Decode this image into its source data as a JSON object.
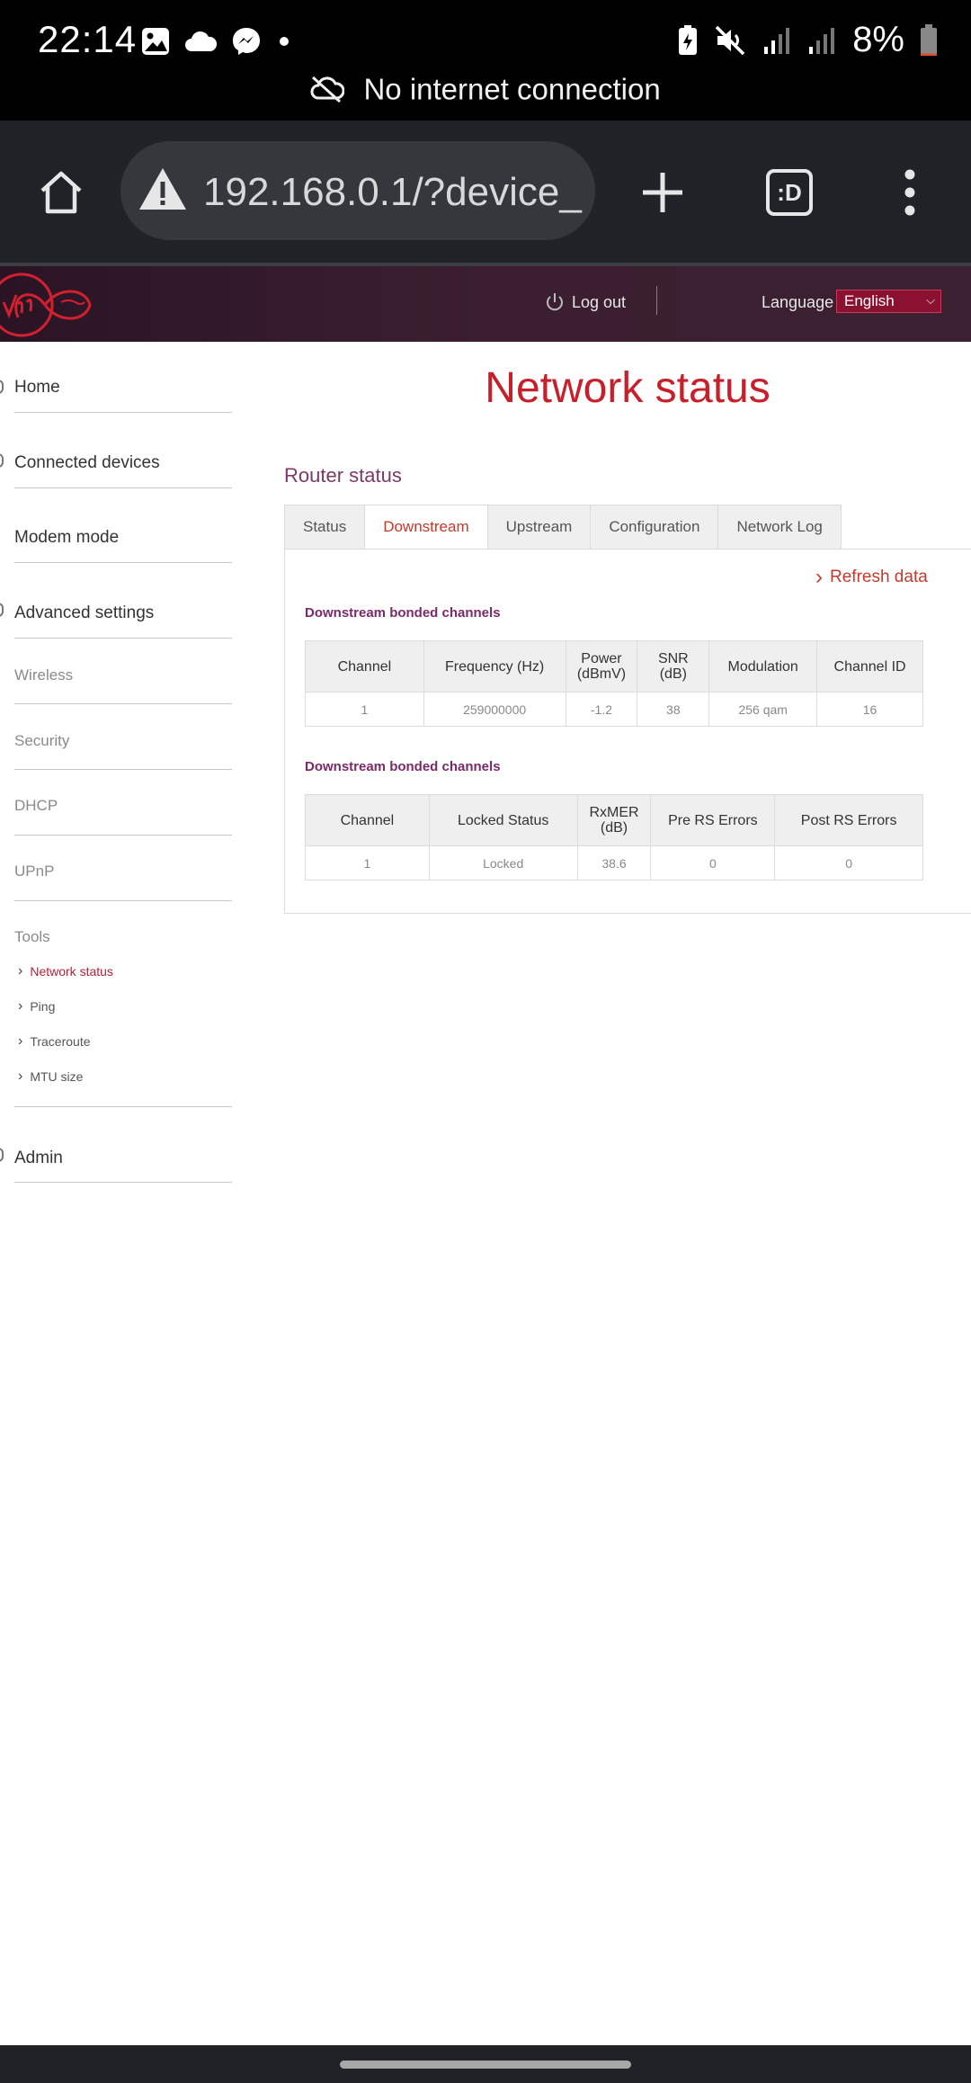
{
  "status_bar": {
    "time": "22:14",
    "battery_percent": "8%",
    "battery_level": 0.08,
    "notice": "No internet connection",
    "icons_left": [
      "gallery-icon",
      "cloud-icon",
      "messenger-icon",
      "dot-icon"
    ],
    "icons_right": [
      "battery-saver-icon",
      "mute-icon",
      "signal-icon",
      "signal-icon",
      "battery-icon"
    ]
  },
  "browser": {
    "url": "192.168.0.1/?device_",
    "icons": [
      "home-icon",
      "warning-icon",
      "new-tab-icon",
      "tab-switcher-icon",
      "menu-icon"
    ],
    "tab_switcher_label": ":D"
  },
  "header": {
    "logout": "Log out",
    "language_label": "Language",
    "language_value": "English"
  },
  "sidebar": {
    "main": [
      "Home",
      "Connected devices",
      "Modem mode",
      "Advanced settings"
    ],
    "advanced": [
      "Wireless",
      "Security",
      "DHCP",
      "UPnP"
    ],
    "tools_label": "Tools",
    "tools": [
      "Network status",
      "Ping",
      "Traceroute",
      "MTU size"
    ],
    "admin": "Admin"
  },
  "content": {
    "title": "Network status",
    "section": "Router status",
    "tabs": [
      "Status",
      "Downstream",
      "Upstream",
      "Configuration",
      "Network Log"
    ],
    "active_tab": "Downstream",
    "refresh": "Refresh data",
    "table1": {
      "title": "Downstream bonded channels",
      "headers": [
        "Channel",
        "Frequency (Hz)",
        "Power\n(dBmV)",
        "SNR\n(dB)",
        "Modulation",
        "Channel ID"
      ],
      "row": [
        "1",
        "259000000",
        "-1.2",
        "38",
        "256 qam",
        "16"
      ]
    },
    "table2": {
      "title": "Downstream bonded channels",
      "headers": [
        "Channel",
        "Locked Status",
        "RxMER\n(dB)",
        "Pre RS Errors",
        "Post RS Errors"
      ],
      "row": [
        "1",
        "Locked",
        "38.6",
        "0",
        "0"
      ]
    }
  },
  "colors": {
    "accent_red": "#c8202b",
    "header_purple": "#3b1f30",
    "section_purple": "#7a3a6a"
  }
}
